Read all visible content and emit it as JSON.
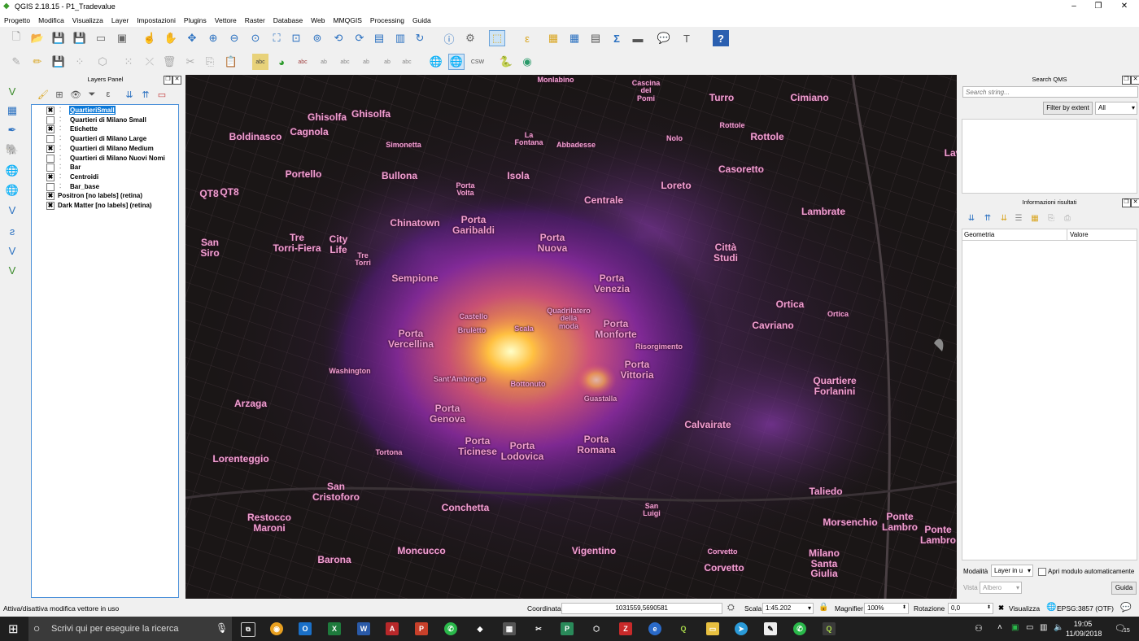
{
  "window": {
    "title": "QGIS 2.18.15 - P1_Tradevalue",
    "minimize": "–",
    "restore": "❐",
    "close": "✕"
  },
  "menu": [
    "Progetto",
    "Modifica",
    "Visualizza",
    "Layer",
    "Impostazioni",
    "Plugins",
    "Vettore",
    "Raster",
    "Database",
    "Web",
    "MMQGIS",
    "Processing",
    "Guida"
  ],
  "layers_panel": {
    "title": "Layers Panel",
    "layers": [
      {
        "name": "QuartieriSmall",
        "checked": true,
        "selected": true,
        "indent": 1
      },
      {
        "name": "Quartieri di Milano Small",
        "checked": false,
        "selected": false,
        "indent": 1
      },
      {
        "name": "Etichette",
        "checked": true,
        "selected": false,
        "indent": 1
      },
      {
        "name": "Quartieri di Milano Large",
        "checked": false,
        "selected": false,
        "indent": 1
      },
      {
        "name": "Quartieri di Milano Medium",
        "checked": true,
        "selected": false,
        "indent": 1
      },
      {
        "name": "Quartieri di Milano Nuovi Nomi",
        "checked": false,
        "selected": false,
        "indent": 1
      },
      {
        "name": "Bar",
        "checked": false,
        "selected": false,
        "indent": 1
      },
      {
        "name": "Centroidi",
        "checked": true,
        "selected": false,
        "indent": 1
      },
      {
        "name": "Bar_base",
        "checked": false,
        "selected": false,
        "indent": 1
      },
      {
        "name": "Positron [no labels] (retina)",
        "checked": true,
        "selected": false,
        "indent": 0
      },
      {
        "name": "Dark Matter [no labels] (retina)",
        "checked": true,
        "selected": false,
        "indent": 0
      }
    ]
  },
  "search_qms": {
    "title": "Search QMS",
    "placeholder": "Search string...",
    "filter_button": "Filter by extent",
    "filter_value": "All"
  },
  "identify": {
    "title": "Informazioni risultati",
    "col_geometry": "Geometria",
    "col_value": "Valore",
    "mode_label": "Modalità",
    "mode_value": "Layer in u",
    "auto_open_label": "Apri modulo automaticamente",
    "view_label": "Vista",
    "view_value": "Albero",
    "help_button": "Guida"
  },
  "toolbar_icons": {
    "csw": "CSW",
    "sigma": "Σ",
    "help": "?"
  },
  "map_labels": [
    {
      "text": "Monlabino",
      "cls": "small"
    },
    {
      "text": "Cascina\ndel\nPomi",
      "cls": "small"
    },
    {
      "text": "Turro",
      "cls": "big"
    },
    {
      "text": "Cimiano",
      "cls": "big"
    },
    {
      "text": "Ghisolfa",
      "cls": "big"
    },
    {
      "text": "Ghisolfa",
      "cls": "big"
    },
    {
      "text": "Boldinasco",
      "cls": "big"
    },
    {
      "text": "Cagnola",
      "cls": "big"
    },
    {
      "text": "La\nFontana",
      "cls": "small"
    },
    {
      "text": "Simonetta",
      "cls": "small"
    },
    {
      "text": "Abbadesse",
      "cls": "small"
    },
    {
      "text": "Rottole",
      "cls": "small"
    },
    {
      "text": "Rottole",
      "cls": "big"
    },
    {
      "text": "Nolo",
      "cls": "small"
    },
    {
      "text": "Lav",
      "cls": "big"
    },
    {
      "text": "Portello",
      "cls": "big"
    },
    {
      "text": "Bullona",
      "cls": "big"
    },
    {
      "text": "Isola",
      "cls": "big"
    },
    {
      "text": "Casoretto",
      "cls": "big"
    },
    {
      "text": "Porta\nVolta",
      "cls": "small"
    },
    {
      "text": "Loreto",
      "cls": "big"
    },
    {
      "text": "QT8",
      "cls": "big"
    },
    {
      "text": "QT8",
      "cls": "big"
    },
    {
      "text": "Centrale",
      "cls": "big"
    },
    {
      "text": "Lambrate",
      "cls": "big"
    },
    {
      "text": "Chinatown",
      "cls": "big"
    },
    {
      "text": "Porta\nGaribaldi",
      "cls": "big"
    },
    {
      "text": "San\nSiro",
      "cls": "big"
    },
    {
      "text": "Tre\nTorri-Fiera",
      "cls": "big"
    },
    {
      "text": "City\nLife",
      "cls": "big"
    },
    {
      "text": "Tre\nTorri",
      "cls": "small"
    },
    {
      "text": "Porta\nNuova",
      "cls": "big"
    },
    {
      "text": "Città\nStudi",
      "cls": "big"
    },
    {
      "text": "Sempione",
      "cls": "big"
    },
    {
      "text": "Porta\nVenezia",
      "cls": "big"
    },
    {
      "text": "Ortica",
      "cls": "big"
    },
    {
      "text": "Ortica",
      "cls": "small"
    },
    {
      "text": "Castello",
      "cls": "small"
    },
    {
      "text": "Quadrilatero\ndella\nmoda",
      "cls": "small"
    },
    {
      "text": "Cavriano",
      "cls": "big"
    },
    {
      "text": "Porta\nVercellina",
      "cls": "big"
    },
    {
      "text": "Brulètto",
      "cls": "small"
    },
    {
      "text": "Scala",
      "cls": "small"
    },
    {
      "text": "Porta\nMonforte",
      "cls": "big"
    },
    {
      "text": "Risorgimento",
      "cls": "small"
    },
    {
      "text": "Washington",
      "cls": "small"
    },
    {
      "text": "Porta\nVittoria",
      "cls": "big"
    },
    {
      "text": "Quartiere\nForlanini",
      "cls": "big"
    },
    {
      "text": "Sant'Ambrogio",
      "cls": "small"
    },
    {
      "text": "Bottonuto",
      "cls": "small"
    },
    {
      "text": "Arzaga",
      "cls": "big"
    },
    {
      "text": "Guastalla",
      "cls": "small"
    },
    {
      "text": "Porta\nGenova",
      "cls": "big"
    },
    {
      "text": "Calvairate",
      "cls": "big"
    },
    {
      "text": "Tortona",
      "cls": "small"
    },
    {
      "text": "Porta\nTicinese",
      "cls": "big"
    },
    {
      "text": "Porta\nLodovica",
      "cls": "big"
    },
    {
      "text": "Porta\nRomana",
      "cls": "big"
    },
    {
      "text": "Lorenteggio",
      "cls": "big"
    },
    {
      "text": "San\nCristoforo",
      "cls": "big"
    },
    {
      "text": "Taliedo",
      "cls": "big"
    },
    {
      "text": "Conchetta",
      "cls": "big"
    },
    {
      "text": "San\nLuigi",
      "cls": "small"
    },
    {
      "text": "Restocco\nMaroni",
      "cls": "big"
    },
    {
      "text": "Morsenchio",
      "cls": "big"
    },
    {
      "text": "Ponte\nLambro",
      "cls": "big"
    },
    {
      "text": "Ponte\nLambro",
      "cls": "big"
    },
    {
      "text": "Moncucco",
      "cls": "big"
    },
    {
      "text": "Vigentino",
      "cls": "big"
    },
    {
      "text": "Corvetto",
      "cls": "small"
    },
    {
      "text": "Corvetto",
      "cls": "big"
    },
    {
      "text": "Barona",
      "cls": "big"
    },
    {
      "text": "Milano\nSanta\nGiulia",
      "cls": "big"
    }
  ],
  "status": {
    "message": "Attiva/disattiva modifica vettore in uso",
    "coord_label": "Coordinata",
    "coord_value": "1031559,5690581",
    "scale_label": "Scala",
    "scale_value": "1:45.202",
    "magnifier_label": "Magnifier",
    "magnifier_value": "100%",
    "rotation_label": "Rotazione",
    "rotation_value": "0,0",
    "render_label": "Visualizza",
    "crs": "EPSG:3857 (OTF)"
  },
  "taskbar": {
    "search_placeholder": "Scrivi qui per eseguire la ricerca",
    "time": "19:05",
    "date": "11/09/2018",
    "notif_count": "15"
  },
  "colors": {
    "map_bg": "#1a1616",
    "label": "#f19fd0",
    "selection": "#0b78d7",
    "taskbar": "#1f1f1f"
  }
}
